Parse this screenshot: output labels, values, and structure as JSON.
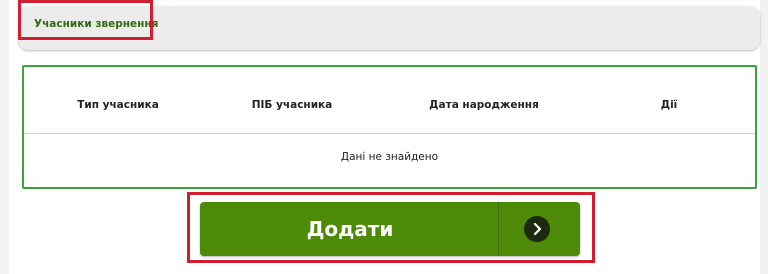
{
  "section": {
    "title": "Учасники звернення"
  },
  "table": {
    "headers": [
      "Тип учасника",
      "ПІБ учасника",
      "Дата народження",
      "Дії"
    ],
    "empty_message": "Дані не знайдено"
  },
  "actions": {
    "add_label": "Додати",
    "add_icon": "chevron-right-icon"
  },
  "colors": {
    "accent_green": "#4c8a08",
    "title_green": "#2f6b12",
    "table_border": "#3ba53b",
    "highlight_red": "#d11f2f"
  }
}
